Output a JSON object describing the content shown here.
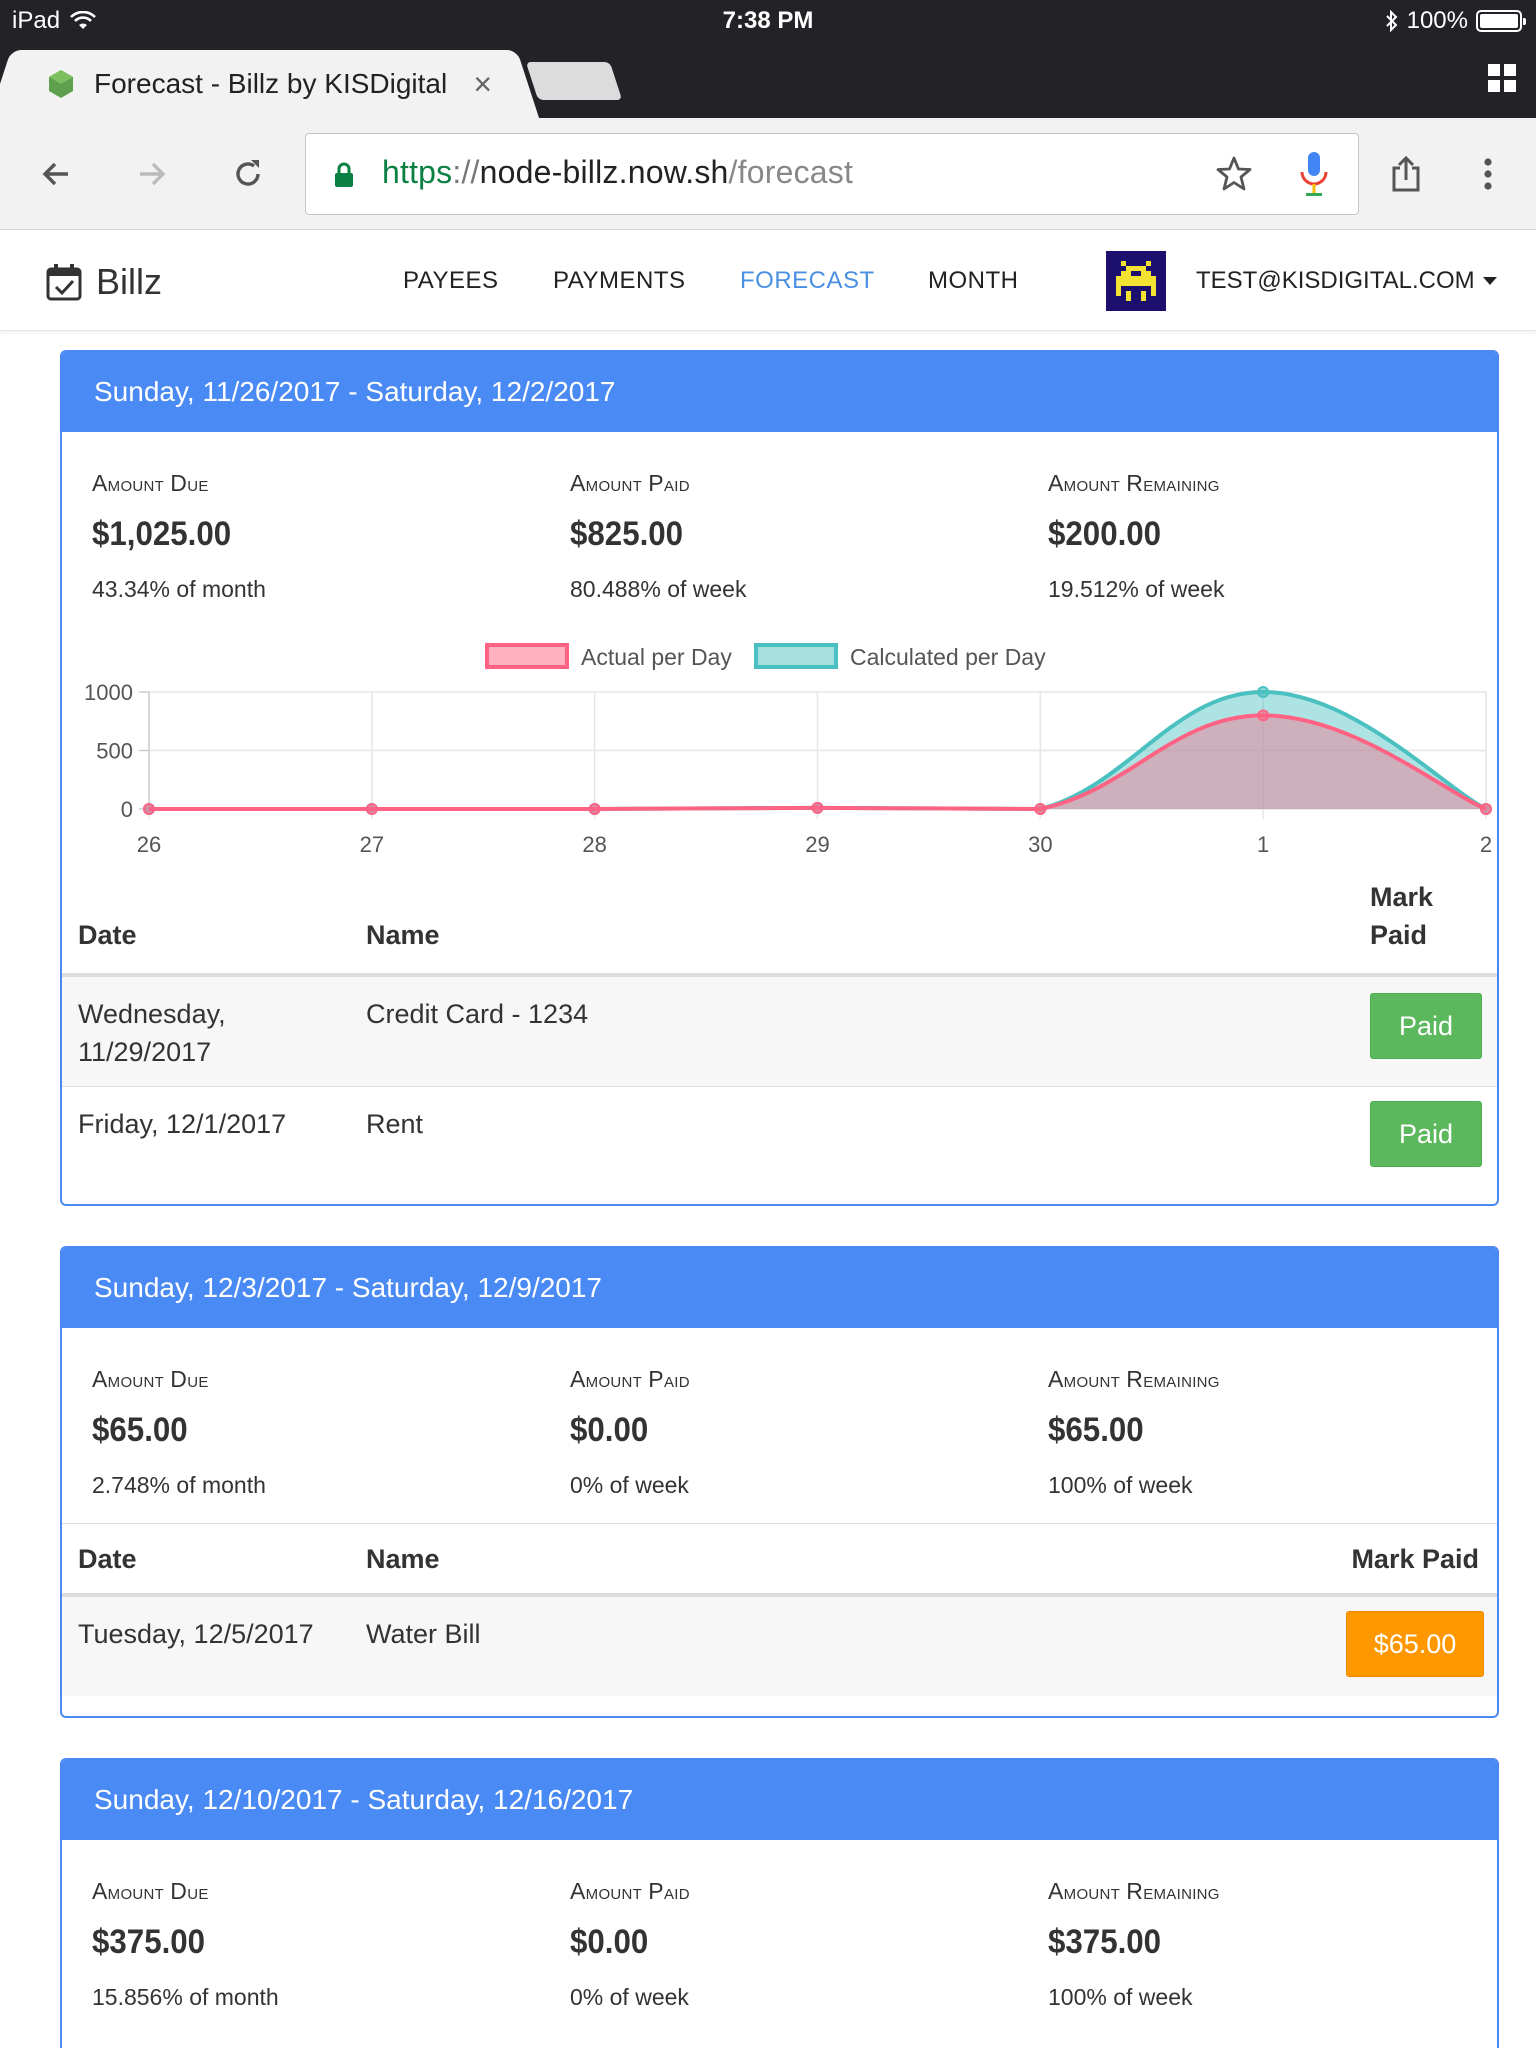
{
  "status_bar": {
    "device": "iPad",
    "time": "7:38 PM",
    "battery": "100%"
  },
  "browser": {
    "tab_title": "Forecast - Billz by KISDigital",
    "tab_close": "×",
    "url": {
      "scheme": "https",
      "sep": "://",
      "host": "node-billz.now.sh",
      "path": "/forecast"
    }
  },
  "navbar": {
    "brand": "Billz",
    "links": [
      "PAYEES",
      "PAYMENTS",
      "FORECAST",
      "MONTH"
    ],
    "active_link": "FORECAST",
    "user": "TEST@KISDIGITAL.COM"
  },
  "weeks": [
    {
      "heading": "Sunday, 11/26/2017 - Saturday, 12/2/2017",
      "stats": [
        {
          "label": "Amount Due",
          "value": "$1,025.00",
          "sub": "43.34% of month"
        },
        {
          "label": "Amount Paid",
          "value": "$825.00",
          "sub": "80.488% of week"
        },
        {
          "label": "Amount Remaining",
          "value": "$200.00",
          "sub": "19.512% of week"
        }
      ],
      "table": {
        "headers": {
          "date": "Date",
          "name": "Name",
          "mark_paid_1": "Mark",
          "mark_paid_2": "Paid"
        },
        "rows": [
          {
            "date_1": "Wednesday,",
            "date_2": "11/29/2017",
            "name": "Credit Card - 1234",
            "button": "Paid"
          },
          {
            "date": "Friday, 12/1/2017",
            "name": "Rent",
            "button": "Paid"
          }
        ]
      }
    },
    {
      "heading": "Sunday, 12/3/2017 - Saturday, 12/9/2017",
      "stats": [
        {
          "label": "Amount Due",
          "value": "$65.00",
          "sub": "2.748% of month"
        },
        {
          "label": "Amount Paid",
          "value": "$0.00",
          "sub": "0% of week"
        },
        {
          "label": "Amount Remaining",
          "value": "$65.00",
          "sub": "100% of week"
        }
      ],
      "table": {
        "headers": {
          "date": "Date",
          "name": "Name",
          "mark_paid": "Mark Paid"
        },
        "rows": [
          {
            "date": "Tuesday, 12/5/2017",
            "name": "Water Bill",
            "button": "$65.00"
          }
        ]
      }
    },
    {
      "heading": "Sunday, 12/10/2017 - Saturday, 12/16/2017",
      "stats": [
        {
          "label": "Amount Due",
          "value": "$375.00",
          "sub": "15.856% of month"
        },
        {
          "label": "Amount Paid",
          "value": "$0.00",
          "sub": "0% of week"
        },
        {
          "label": "Amount Remaining",
          "value": "$375.00",
          "sub": "100% of week"
        }
      ]
    }
  ],
  "chart_data": {
    "type": "area",
    "categories": [
      "26",
      "27",
      "28",
      "29",
      "30",
      "1",
      "2"
    ],
    "series": [
      {
        "name": "Actual per Day",
        "values": [
          0,
          0,
          0,
          10,
          0,
          800,
          0
        ],
        "color": "#ff6384"
      },
      {
        "name": "Calculated per Day",
        "values": [
          0,
          0,
          0,
          10,
          0,
          1000,
          0
        ],
        "color": "#4bc0c0"
      }
    ],
    "ylim": [
      0,
      1000
    ],
    "yticks": [
      0,
      500,
      1000
    ],
    "legend": "top",
    "grid": true
  },
  "colors": {
    "accent": "#4a8af4",
    "paid": "#5cb85c",
    "due": "#ff9800",
    "active_nav": "#4a90e2"
  }
}
